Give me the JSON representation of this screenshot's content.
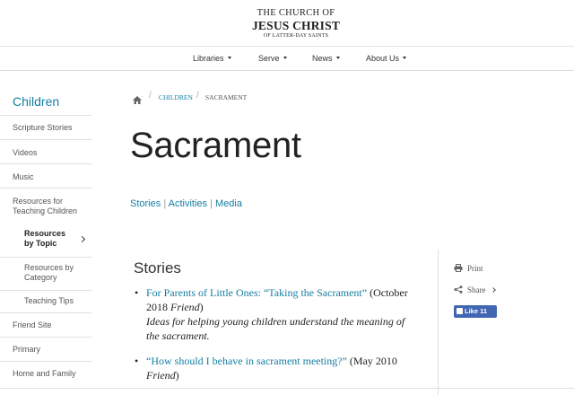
{
  "header": {
    "logo_line1": "THE CHURCH OF",
    "logo_line2": "JESUS CHRIST",
    "logo_line3": "OF LATTER-DAY SAINTS"
  },
  "nav": {
    "items": [
      "Libraries",
      "Serve",
      "News",
      "About Us"
    ]
  },
  "sidebar": {
    "title": "Children",
    "items": [
      "Scripture Stories",
      "Videos",
      "Music",
      "Resources for Teaching Children",
      "Resources by Topic",
      "Resources by Category",
      "Teaching Tips",
      "Friend Site",
      "Primary",
      "Home and Family"
    ]
  },
  "breadcrumb": {
    "home_icon": "home-icon",
    "items": [
      "CHILDREN",
      "SACRAMENT"
    ]
  },
  "page": {
    "title": "Sacrament",
    "links": [
      "Stories",
      "Activities",
      "Media"
    ],
    "link_sep": "|"
  },
  "stories": {
    "heading": "Stories",
    "items": [
      {
        "link": "For Parents of Little Ones: “Taking the Sacrament”",
        "date": "(October 2018",
        "source": "Friend",
        "close": ")",
        "desc": "Ideas for helping young children understand the meaning of the sacrament."
      },
      {
        "link": "“How should I behave in sacrament meeting?”",
        "date": "(May 2010",
        "source": "Friend",
        "close": ")",
        "desc": ""
      }
    ]
  },
  "tools": {
    "print": "Print",
    "share": "Share",
    "like": "Like 11"
  },
  "colors": {
    "link": "#157ea2",
    "facebook": "#4267b2"
  }
}
